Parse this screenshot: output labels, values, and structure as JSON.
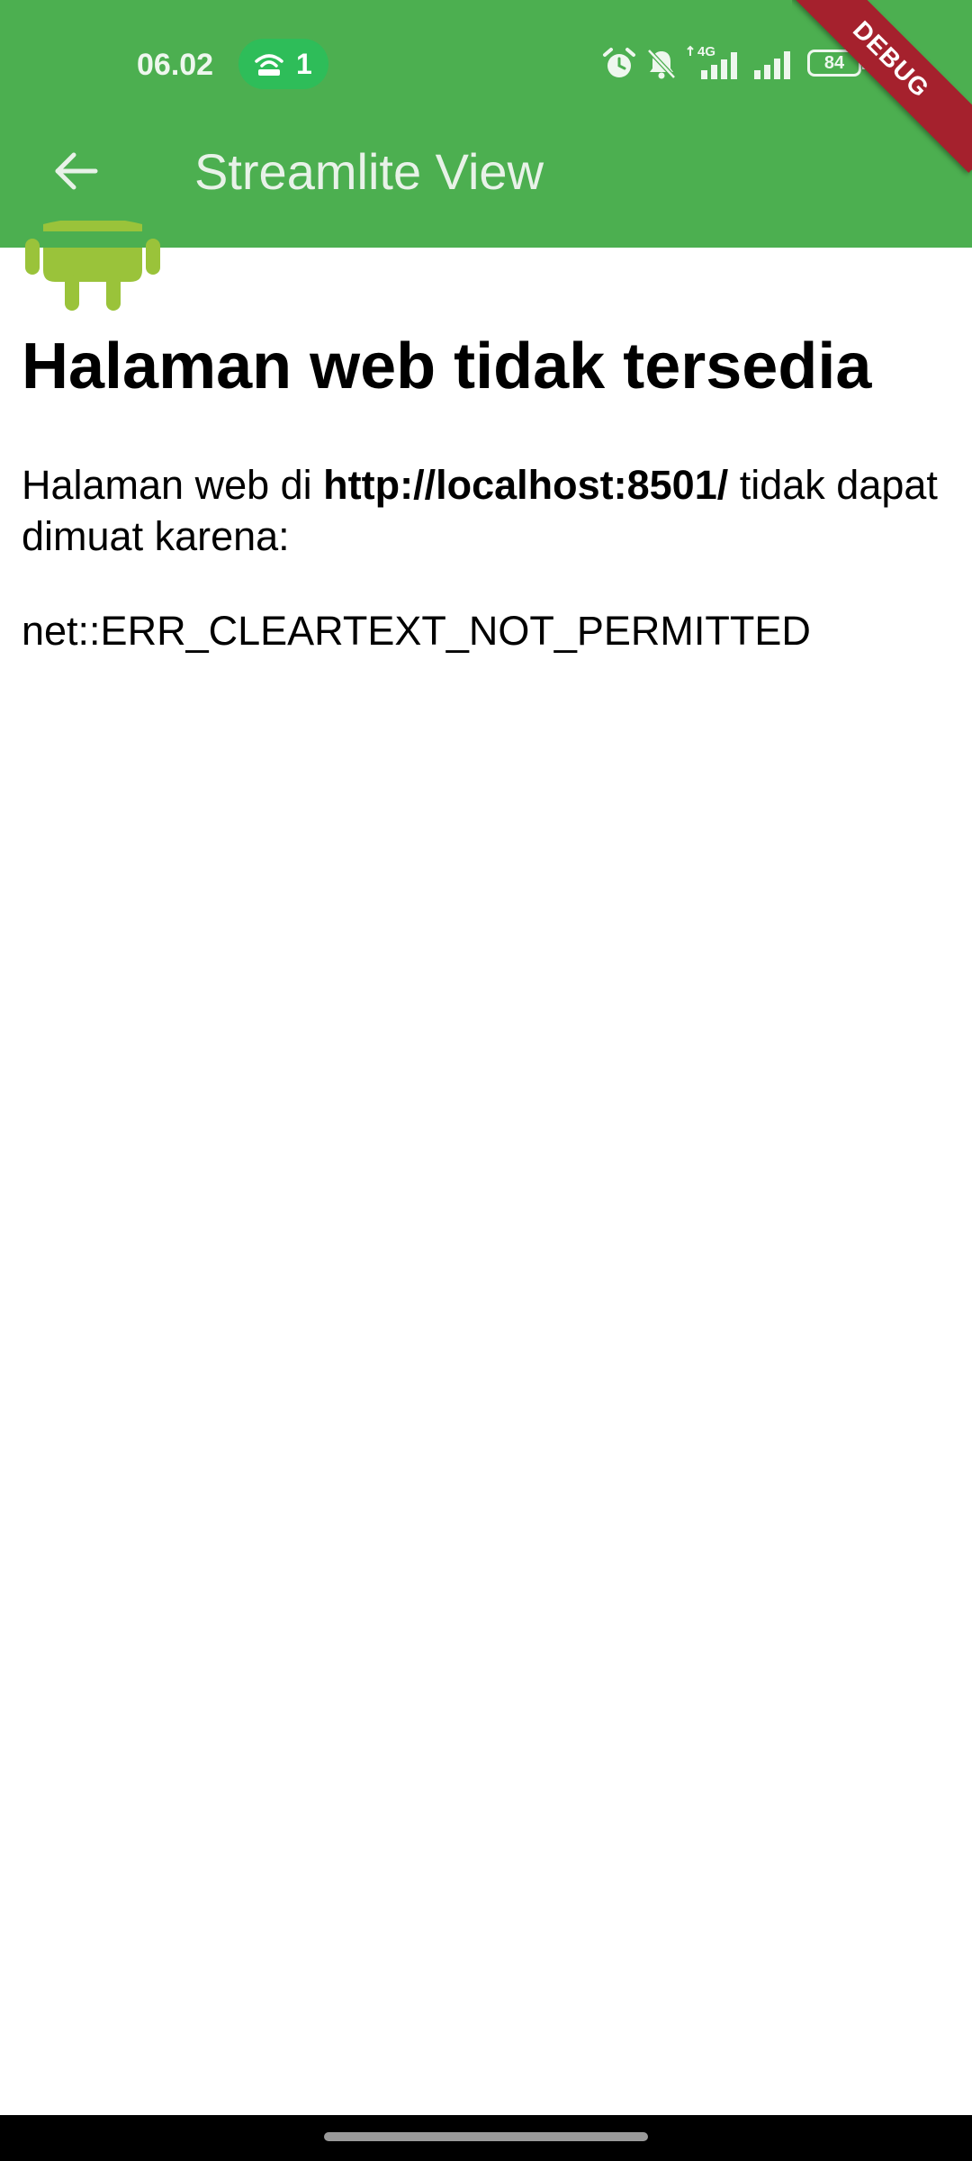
{
  "status_bar": {
    "time": "06.02",
    "hotspot_count": "1",
    "network_type": "4G",
    "battery_level": "84",
    "icons": [
      "hotspot-icon",
      "alarm-icon",
      "mute-icon",
      "signal-icon",
      "signal-icon",
      "battery-icon",
      "charging-icon"
    ]
  },
  "appbar": {
    "title": "Streamlite View",
    "back_icon": "arrow-back-icon",
    "background_color": "#4caf50"
  },
  "debug_banner": {
    "label": "DEBUG",
    "color": "#a5212d"
  },
  "webview_error": {
    "logo_icon": "android-robot-icon",
    "heading": "Halaman web tidak tersedia",
    "message_prefix": "Halaman web di ",
    "url": "http://localhost:8501/",
    "message_suffix": " tidak dapat dimuat karena:",
    "error_code": "net::ERR_CLEARTEXT_NOT_PERMITTED"
  }
}
